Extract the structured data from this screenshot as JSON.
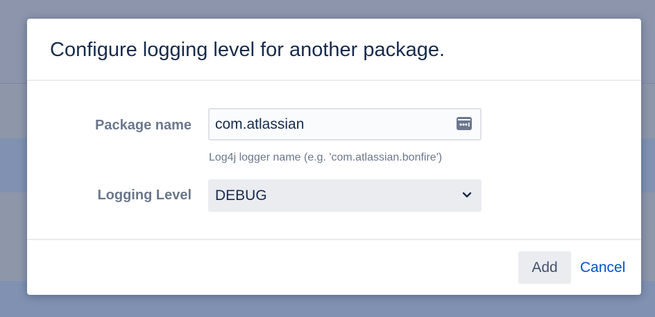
{
  "dialog": {
    "title": "Configure logging level for another package."
  },
  "form": {
    "package_name": {
      "label": "Package name",
      "value": "com.atlassian",
      "help": "Log4j logger name (e.g. 'com.atlassian.bonfire')",
      "trailing_icon": "password-manager-autofill-icon"
    },
    "logging_level": {
      "label": "Logging Level",
      "selected": "DEBUG",
      "icon": "chevron-down-icon"
    }
  },
  "footer": {
    "add_label": "Add",
    "cancel_label": "Cancel"
  },
  "colors": {
    "blanket": "#8b93a8",
    "title": "#172b4d",
    "label": "#6b778c",
    "link": "#0052cc",
    "button_bg": "#ebecf0"
  }
}
